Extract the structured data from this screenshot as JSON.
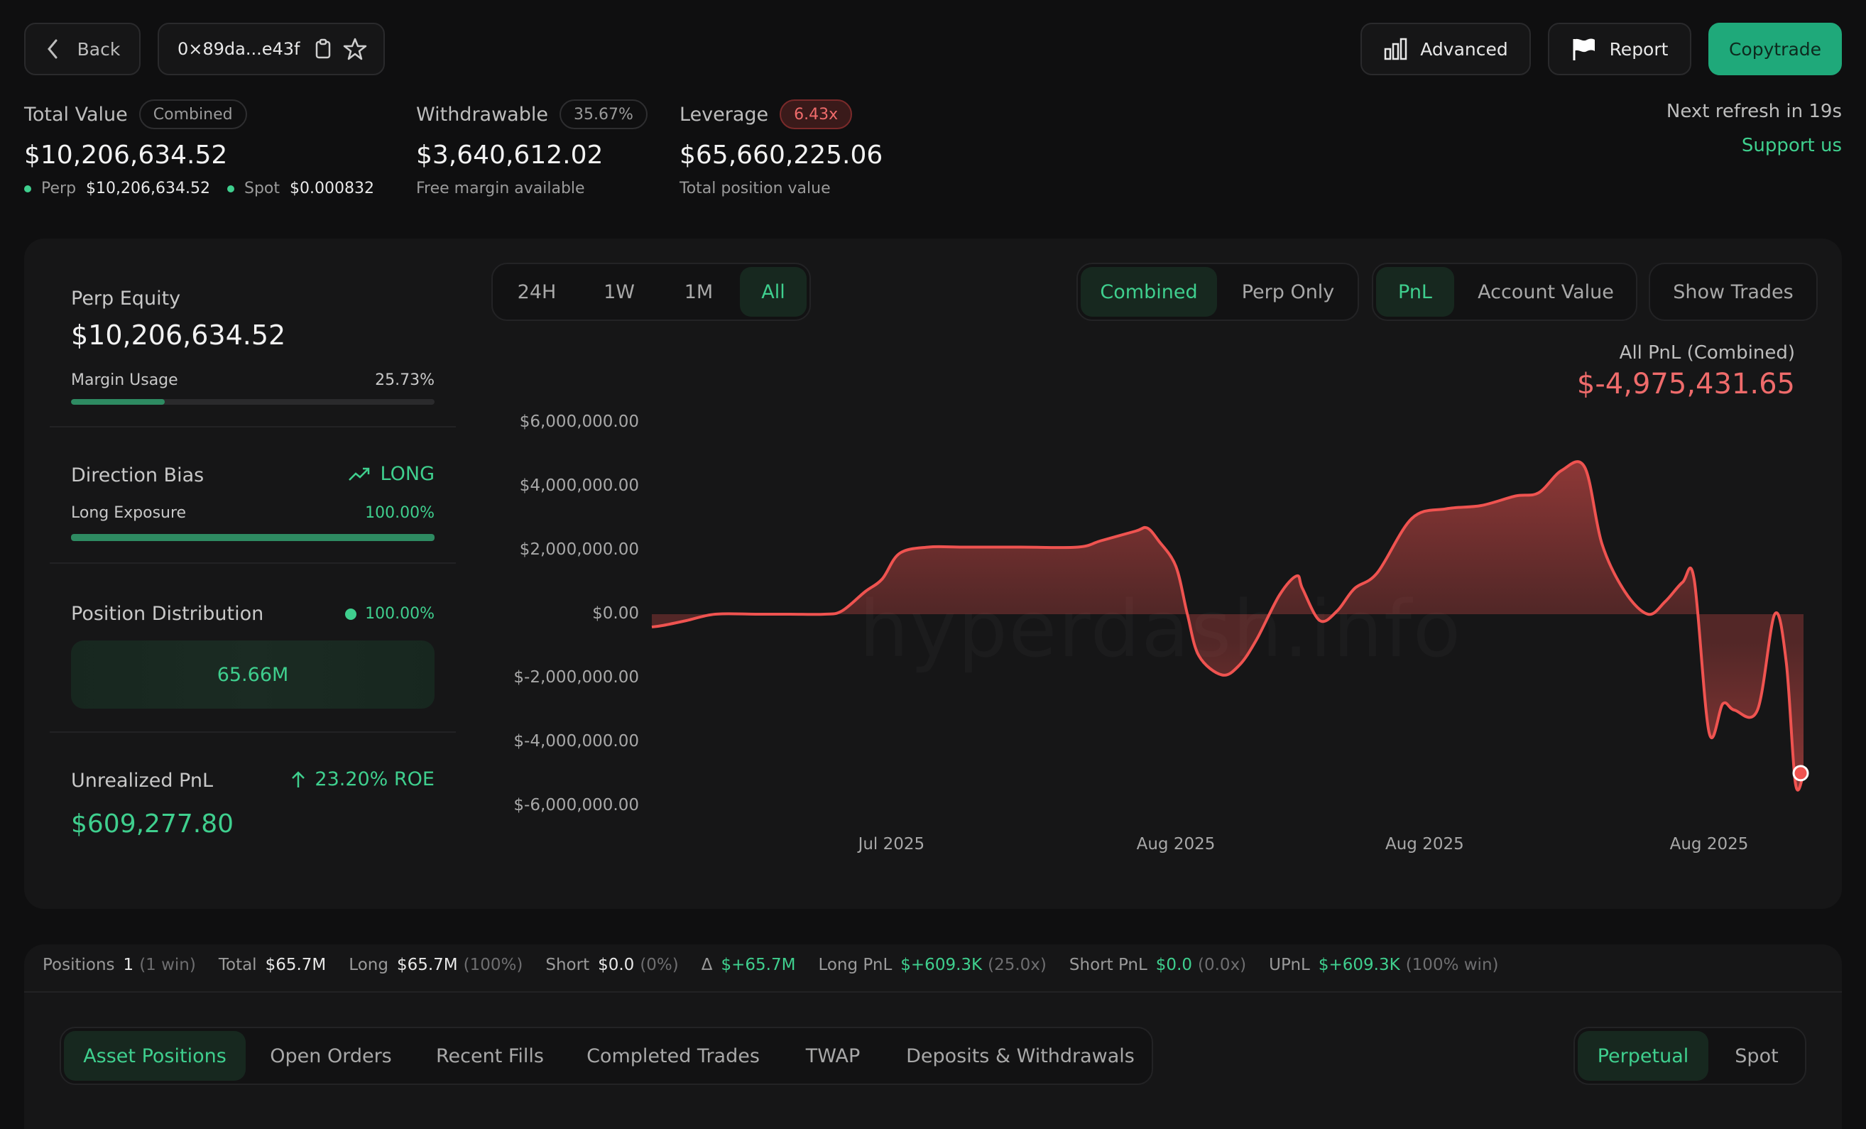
{
  "header": {
    "back_label": "Back",
    "address": "0×89da...e43f",
    "advanced_label": "Advanced",
    "report_label": "Report",
    "copytrade_label": "Copytrade"
  },
  "summary": {
    "total_value_label": "Total Value",
    "total_value_badge": "Combined",
    "total_value": "$10,206,634.52",
    "perp_label": "Perp",
    "perp_value": "$10,206,634.52",
    "spot_label": "Spot",
    "spot_value": "$0.000832",
    "withdrawable_label": "Withdrawable",
    "withdrawable_badge": "35.67%",
    "withdrawable_value": "$3,640,612.02",
    "withdrawable_sub": "Free margin available",
    "leverage_label": "Leverage",
    "leverage_badge": "6.43x",
    "leverage_value": "$65,660,225.06",
    "leverage_sub": "Total position value",
    "refresh_text": "Next refresh in 19s",
    "support_link": "Support us"
  },
  "left_panel": {
    "perp_equity_label": "Perp Equity",
    "perp_equity_value": "$10,206,634.52",
    "margin_usage_label": "Margin Usage",
    "margin_usage_value": "25.73%",
    "margin_usage_fraction": 0.2573,
    "direction_bias_label": "Direction Bias",
    "direction_bias_value": "LONG",
    "long_exposure_label": "Long Exposure",
    "long_exposure_value": "100.00%",
    "long_exposure_fraction": 1.0,
    "position_distribution_label": "Position Distribution",
    "position_distribution_value": "100.00%",
    "position_distribution_block": "65.66M",
    "unrealized_pnl_label": "Unrealized PnL",
    "unrealized_pnl_roe": "23.20% ROE",
    "unrealized_pnl_value": "$609,277.80"
  },
  "chart_controls": {
    "ranges": [
      "24H",
      "1W",
      "1M",
      "All"
    ],
    "active_range": "All",
    "modes": [
      "Combined",
      "Perp Only"
    ],
    "active_mode": "Combined",
    "metrics": [
      "PnL",
      "Account Value"
    ],
    "active_metric": "PnL",
    "show_trades_label": "Show Trades",
    "pnl_title": "All PnL (Combined)",
    "pnl_value": "$-4,975,431.65",
    "watermark": "hyperdash.info"
  },
  "chart_data": {
    "type": "area",
    "title": "All PnL (Combined)",
    "xlabel": "",
    "ylabel": "",
    "ylim": [
      -6000000,
      6000000
    ],
    "yticks": [
      "$6,000,000.00",
      "$4,000,000.00",
      "$2,000,000.00",
      "$0.00",
      "$-2,000,000.00",
      "$-4,000,000.00",
      "$-6,000,000.00"
    ],
    "ytick_values": [
      6000000,
      4000000,
      2000000,
      0,
      -2000000,
      -4000000,
      -6000000
    ],
    "xticks": [
      "Jul 2025",
      "Aug 2025",
      "Aug 2025",
      "Aug 2025"
    ],
    "xtick_positions": [
      0.208,
      0.455,
      0.671,
      0.918
    ],
    "grid": false,
    "line_color": "#ef5350",
    "series": [
      {
        "values": [
          [
            0.0,
            -400000
          ],
          [
            0.01,
            -350000
          ],
          [
            0.03,
            -200000
          ],
          [
            0.055,
            0
          ],
          [
            0.09,
            0
          ],
          [
            0.12,
            0
          ],
          [
            0.15,
            0
          ],
          [
            0.165,
            100000
          ],
          [
            0.185,
            700000
          ],
          [
            0.2,
            1100000
          ],
          [
            0.215,
            1900000
          ],
          [
            0.24,
            2100000
          ],
          [
            0.27,
            2100000
          ],
          [
            0.32,
            2100000
          ],
          [
            0.37,
            2100000
          ],
          [
            0.39,
            2300000
          ],
          [
            0.42,
            2600000
          ],
          [
            0.43,
            2700000
          ],
          [
            0.44,
            2300000
          ],
          [
            0.455,
            1500000
          ],
          [
            0.465,
            0
          ],
          [
            0.475,
            -1300000
          ],
          [
            0.495,
            -1900000
          ],
          [
            0.51,
            -1600000
          ],
          [
            0.525,
            -800000
          ],
          [
            0.545,
            600000
          ],
          [
            0.56,
            1200000
          ],
          [
            0.565,
            800000
          ],
          [
            0.58,
            -200000
          ],
          [
            0.595,
            100000
          ],
          [
            0.61,
            800000
          ],
          [
            0.63,
            1300000
          ],
          [
            0.66,
            3000000
          ],
          [
            0.69,
            3300000
          ],
          [
            0.72,
            3400000
          ],
          [
            0.75,
            3700000
          ],
          [
            0.77,
            3800000
          ],
          [
            0.79,
            4500000
          ],
          [
            0.81,
            4600000
          ],
          [
            0.825,
            2200000
          ],
          [
            0.845,
            700000
          ],
          [
            0.865,
            0
          ],
          [
            0.88,
            400000
          ],
          [
            0.895,
            1000000
          ],
          [
            0.905,
            1100000
          ],
          [
            0.918,
            -3700000
          ],
          [
            0.93,
            -2800000
          ],
          [
            0.94,
            -3000000
          ],
          [
            0.96,
            -3000000
          ],
          [
            0.975,
            0
          ],
          [
            0.985,
            -1500000
          ],
          [
            0.993,
            -5300000
          ],
          [
            1.0,
            -5000000
          ]
        ]
      }
    ]
  },
  "stats_bar": {
    "positions_label": "Positions",
    "positions_value": "1",
    "positions_extra": "(1 win)",
    "total_label": "Total",
    "total_value": "$65.7M",
    "long_label": "Long",
    "long_value": "$65.7M",
    "long_extra": "(100%)",
    "short_label": "Short",
    "short_value": "$0.0",
    "short_extra": "(0%)",
    "delta_label": "Δ",
    "delta_value": "$+65.7M",
    "long_pnl_label": "Long PnL",
    "long_pnl_value": "$+609.3K",
    "long_pnl_extra": "(25.0x)",
    "short_pnl_label": "Short PnL",
    "short_pnl_value": "$0.0",
    "short_pnl_extra": "(0.0x)",
    "upnl_label": "UPnL",
    "upnl_value": "$+609.3K",
    "upnl_extra": "(100% win)"
  },
  "bottom_tabs": {
    "tabs": [
      "Asset Positions",
      "Open Orders",
      "Recent Fills",
      "Completed Trades",
      "TWAP",
      "Deposits & Withdrawals"
    ],
    "active_tab": "Asset Positions",
    "market_tabs": [
      "Perpetual",
      "Spot"
    ],
    "active_market": "Perpetual"
  },
  "colors": {
    "accent_green": "#3fcf8e",
    "loss_red": "#ef5350",
    "copytrade_bg": "#1fa97a"
  }
}
